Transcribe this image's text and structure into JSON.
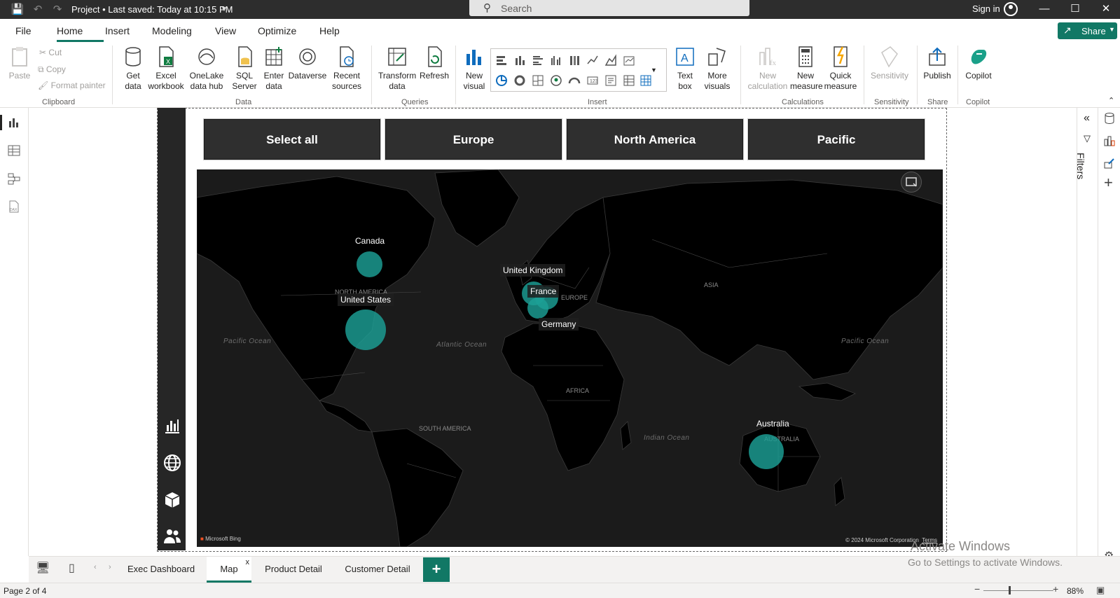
{
  "titlebar": {
    "title": "Project • Last saved: Today at 10:15 PM",
    "search_placeholder": "Search",
    "signin": "Sign in"
  },
  "menu": {
    "file": "File",
    "home": "Home",
    "insert": "Insert",
    "modeling": "Modeling",
    "view": "View",
    "optimize": "Optimize",
    "help": "Help",
    "share": "Share"
  },
  "ribbon": {
    "clipboard": {
      "paste": "Paste",
      "cut": "Cut",
      "copy": "Copy",
      "format_painter": "Format painter",
      "label": "Clipboard"
    },
    "data": {
      "get_data": [
        "Get",
        "data"
      ],
      "excel": [
        "Excel",
        "workbook"
      ],
      "onelake": [
        "OneLake",
        "data hub"
      ],
      "sql": [
        "SQL",
        "Server"
      ],
      "enter": [
        "Enter",
        "data"
      ],
      "dataverse": "Dataverse",
      "recent": [
        "Recent",
        "sources"
      ],
      "label": "Data"
    },
    "queries": {
      "transform": [
        "Transform",
        "data"
      ],
      "refresh": "Refresh",
      "label": "Queries"
    },
    "insert": {
      "new_visual": [
        "New",
        "visual"
      ],
      "text_box": [
        "Text",
        "box"
      ],
      "more_visuals": [
        "More",
        "visuals"
      ],
      "label": "Insert"
    },
    "calculations": {
      "new_calc": [
        "New",
        "calculation"
      ],
      "new_measure": [
        "New",
        "measure"
      ],
      "quick_measure": [
        "Quick",
        "measure"
      ],
      "label": "Calculations"
    },
    "sensitivity": {
      "btn": "Sensitivity",
      "label": "Sensitivity"
    },
    "share": {
      "publish": "Publish",
      "label": "Share"
    },
    "copilot": {
      "btn": "Copilot",
      "label": "Copilot"
    }
  },
  "slicer": [
    "Select all",
    "Europe",
    "North America",
    "Pacific"
  ],
  "map": {
    "countries": [
      {
        "name": "Canada",
        "label": "Canada"
      },
      {
        "name": "United States",
        "label": "United States"
      },
      {
        "name": "United Kingdom",
        "label": "United Kingdom"
      },
      {
        "name": "France",
        "label": "France"
      },
      {
        "name": "Germany",
        "label": "Germany"
      },
      {
        "name": "Australia",
        "label": "Australia"
      }
    ],
    "oceans": {
      "pacific_left": "Pacific Ocean",
      "pacific_right": "Pacific Ocean",
      "atlantic": "Atlantic Ocean",
      "indian": "Indian Ocean"
    },
    "continents": {
      "na": "NORTH AMERICA",
      "eu": "EUROPE",
      "asia": "ASIA",
      "africa": "AFRICA",
      "sa": "SOUTH AMERICA",
      "au": "AUSTRALIA"
    },
    "bing": "Microsoft Bing",
    "copyright": "© 2024 Microsoft Corporation",
    "terms": "Terms"
  },
  "filters_label": "Filters",
  "pages": [
    "Exec Dashboard",
    "Map",
    "Product Detail",
    "Customer Detail"
  ],
  "active_page": "Map",
  "status": {
    "page": "Page 2 of 4",
    "zoom": "88%",
    "activate_title": "Activate Windows",
    "activate_sub": "Go to Settings to activate Windows."
  },
  "colors": {
    "accent": "#117865",
    "bubble": "#1ca096",
    "map_bg": "#1b1b1b",
    "slicer_bg": "#2f2f2f"
  }
}
